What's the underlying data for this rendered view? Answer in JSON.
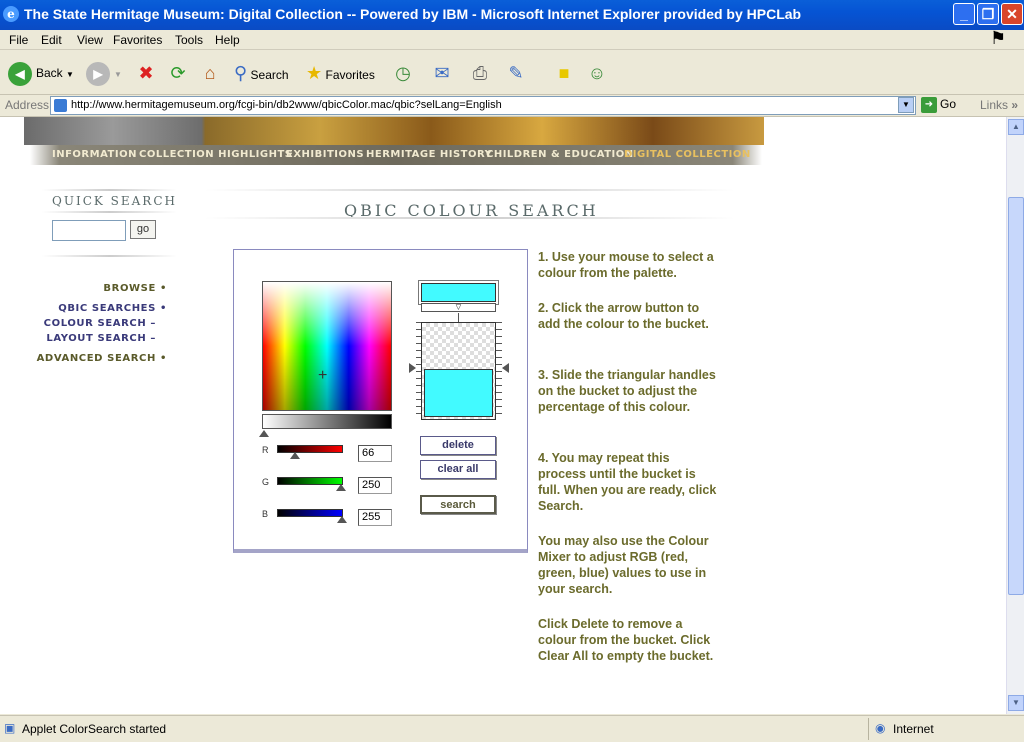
{
  "window": {
    "title": "The State Hermitage Museum: Digital Collection -- Powered by IBM - Microsoft Internet Explorer provided by HPCLab",
    "controls": {
      "minimize": "_",
      "maximize": "❐",
      "close": "✕"
    }
  },
  "menu": [
    "File",
    "Edit",
    "View",
    "Favorites",
    "Tools",
    "Help"
  ],
  "toolbar": {
    "back": "Back",
    "search": "Search",
    "favorites": "Favorites"
  },
  "address": {
    "label": "Address",
    "url": "http://www.hermitagemuseum.org/fcgi-bin/db2www/qbicColor.mac/qbic?selLang=English",
    "go": "Go",
    "links": "Links"
  },
  "site_nav": [
    "INFORMATION",
    "COLLECTION HIGHLIGHTS",
    "EXHIBITIONS",
    "HERMITAGE HISTORY",
    "CHILDREN & EDUCATION",
    "DIGITAL COLLECTION"
  ],
  "quick_search": {
    "title": "QUICK SEARCH",
    "go": "go",
    "value": ""
  },
  "left_nav": {
    "browse": "BROWSE",
    "qbic": "QBIC SEARCHES",
    "colour": "COLOUR SEARCH",
    "layout": "LAYOUT SEARCH",
    "advanced": "ADVANCED SEARCH"
  },
  "page_title": "QBIC COLOUR SEARCH",
  "mixer": {
    "r_label": "R",
    "g_label": "G",
    "b_label": "B",
    "r": "66",
    "g": "250",
    "b": "255",
    "selected_color": "#42faff",
    "bucket_fill_fraction": 0.5
  },
  "buttons": {
    "delete": "delete",
    "clear_all": "clear all",
    "search": "search"
  },
  "instructions": [
    "1. Use your mouse to select a colour from the palette.",
    "2. Click the arrow button to add the colour to the bucket.",
    "3. Slide the triangular handles on the bucket to adjust the percentage of this colour.",
    "4. You may repeat this process until the bucket is full. When you are ready, click Search.",
    "You may also use the Colour Mixer to adjust RGB (red, green, blue) values to use in your search.",
    "Click Delete to remove a colour from the bucket. Click Clear All to empty the bucket."
  ],
  "status": {
    "message": "Applet ColorSearch started",
    "zone": "Internet"
  }
}
